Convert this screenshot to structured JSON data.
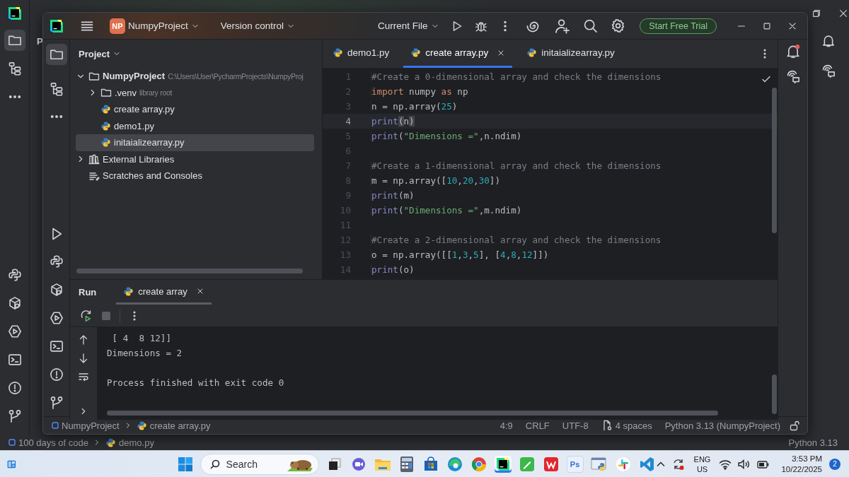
{
  "background_window": {
    "title_fragment": "P",
    "project_selected": true,
    "breadcrumb": [
      {
        "label": "100 days of code",
        "kind": "module"
      },
      {
        "label": "demo.py",
        "kind": "python"
      }
    ],
    "interpreter": "Python 3.13"
  },
  "window": {
    "project_badge": "NP",
    "project": "NumpyProject",
    "vcs": "Version control",
    "run_config": "Current File",
    "trial_button": "Start Free Trial",
    "project_selected": true
  },
  "project_panel": {
    "title": "Project",
    "tree": [
      {
        "label": "NumpyProject",
        "note": "C:\\Users\\User\\PycharmProjects\\NumpyProj",
        "kind": "project",
        "expanded": true,
        "selected": false,
        "children": [
          {
            "label": ".venv",
            "note": "library root",
            "kind": "folder",
            "expanded": false,
            "selected": false
          },
          {
            "label": "create array.py",
            "kind": "python",
            "selected": false
          },
          {
            "label": "demo1.py",
            "kind": "python",
            "selected": false
          },
          {
            "label": "initaializearray.py",
            "kind": "python",
            "selected": true
          }
        ]
      },
      {
        "label": "External Libraries",
        "kind": "library",
        "expanded": false,
        "selected": false
      },
      {
        "label": "Scratches and Consoles",
        "kind": "scratches",
        "selected": false
      }
    ]
  },
  "editor": {
    "tabs": [
      {
        "label": "demo1.py",
        "selected": false
      },
      {
        "label": "create array.py",
        "selected": true
      },
      {
        "label": "initaializearray.py",
        "selected": false
      }
    ],
    "inspection_ok": true,
    "lines": [
      {
        "number": "1",
        "current": false,
        "tokens": [
          {
            "kind": "comment",
            "text": "#Create a 0-dimensional array and check the dimensions"
          }
        ]
      },
      {
        "number": "2",
        "current": false,
        "tokens": [
          {
            "kind": "keyword",
            "text": "import"
          },
          {
            "kind": "plain",
            "text": " numpy "
          },
          {
            "kind": "keyword",
            "text": "as"
          },
          {
            "kind": "plain",
            "text": " np"
          }
        ]
      },
      {
        "number": "3",
        "current": false,
        "tokens": [
          {
            "kind": "plain",
            "text": "n = np.array("
          },
          {
            "kind": "number",
            "text": "25"
          },
          {
            "kind": "plain",
            "text": ")"
          }
        ]
      },
      {
        "number": "4",
        "current": true,
        "tokens": [
          {
            "kind": "builtin",
            "text": "print"
          },
          {
            "kind": "match",
            "text": "("
          },
          {
            "kind": "plain",
            "text": "n"
          },
          {
            "kind": "match",
            "text": ")"
          }
        ]
      },
      {
        "number": "5",
        "current": false,
        "tokens": [
          {
            "kind": "builtin",
            "text": "print"
          },
          {
            "kind": "plain",
            "text": "("
          },
          {
            "kind": "string",
            "text": "\"Dimensions =\""
          },
          {
            "kind": "plain",
            "text": ",n.ndim)"
          }
        ]
      },
      {
        "number": "6",
        "current": false
      },
      {
        "number": "7",
        "current": false,
        "tokens": [
          {
            "kind": "comment",
            "text": "#Create a 1-dimensional array and check the dimensions"
          }
        ]
      },
      {
        "number": "8",
        "current": false,
        "tokens": [
          {
            "kind": "plain",
            "text": "m = np.array(["
          },
          {
            "kind": "number",
            "text": "10"
          },
          {
            "kind": "plain",
            "text": ","
          },
          {
            "kind": "number",
            "text": "20"
          },
          {
            "kind": "plain",
            "text": ","
          },
          {
            "kind": "number",
            "text": "30"
          },
          {
            "kind": "plain",
            "text": "])"
          }
        ]
      },
      {
        "number": "9",
        "current": false,
        "tokens": [
          {
            "kind": "builtin",
            "text": "print"
          },
          {
            "kind": "plain",
            "text": "(m)"
          }
        ]
      },
      {
        "number": "10",
        "current": false,
        "tokens": [
          {
            "kind": "builtin",
            "text": "print"
          },
          {
            "kind": "plain",
            "text": "("
          },
          {
            "kind": "string",
            "text": "\"Dimensions =\""
          },
          {
            "kind": "plain",
            "text": ",m.ndim)"
          }
        ]
      },
      {
        "number": "11",
        "current": false
      },
      {
        "number": "12",
        "current": false,
        "tokens": [
          {
            "kind": "comment",
            "text": "#Create a 2-dimensional array and check the dimensions"
          }
        ]
      },
      {
        "number": "13",
        "current": false,
        "tokens": [
          {
            "kind": "plain",
            "text": "o = np.array([["
          },
          {
            "kind": "number",
            "text": "1"
          },
          {
            "kind": "plain",
            "text": ","
          },
          {
            "kind": "number",
            "text": "3"
          },
          {
            "kind": "plain",
            "text": ","
          },
          {
            "kind": "number",
            "text": "5"
          },
          {
            "kind": "plain",
            "text": "], ["
          },
          {
            "kind": "number",
            "text": "4"
          },
          {
            "kind": "plain",
            "text": ","
          },
          {
            "kind": "number",
            "text": "8"
          },
          {
            "kind": "plain",
            "text": ","
          },
          {
            "kind": "number",
            "text": "12"
          },
          {
            "kind": "plain",
            "text": "]])"
          }
        ]
      },
      {
        "number": "14",
        "current": false,
        "tokens": [
          {
            "kind": "builtin",
            "text": "print"
          },
          {
            "kind": "plain",
            "text": "(o)"
          }
        ]
      }
    ]
  },
  "run_panel": {
    "title": "Run",
    "tabs": [
      {
        "label": "create array",
        "selected": true
      }
    ],
    "output_blocks": [
      [
        " [ 4  8 12]]",
        "Dimensions = 2"
      ],
      [
        "Process finished with exit code 0"
      ]
    ]
  },
  "status_bar": {
    "breadcrumb": [
      {
        "label": "NumpyProject",
        "kind": "module"
      },
      {
        "label": "create array.py",
        "kind": "python"
      }
    ],
    "position": "4:9",
    "line_separator": "CRLF",
    "encoding": "UTF-8",
    "indent": "4 spaces",
    "interpreter": "Python 3.13 (NumpyProject)"
  },
  "taskbar": {
    "search_placeholder": "Search",
    "apps": [
      {
        "kind": "task-view",
        "active": false
      },
      {
        "kind": "meet",
        "active": false
      },
      {
        "kind": "explorer",
        "active": false
      },
      {
        "kind": "calculator",
        "active": false
      },
      {
        "kind": "store",
        "active": false
      },
      {
        "kind": "edge",
        "active": false
      },
      {
        "kind": "chrome",
        "active": false
      },
      {
        "kind": "pycharm",
        "active": true
      },
      {
        "kind": "notes",
        "active": false
      },
      {
        "kind": "wps",
        "active": false
      },
      {
        "kind": "photoshop",
        "label": "Ps",
        "active": false
      },
      {
        "kind": "python",
        "active": false
      },
      {
        "kind": "slack",
        "active": false
      },
      {
        "kind": "vscode",
        "active": false
      }
    ],
    "language": "ENG",
    "region": "US",
    "time": "3:53 PM",
    "date": "10/22/2025",
    "notifications": "2"
  }
}
